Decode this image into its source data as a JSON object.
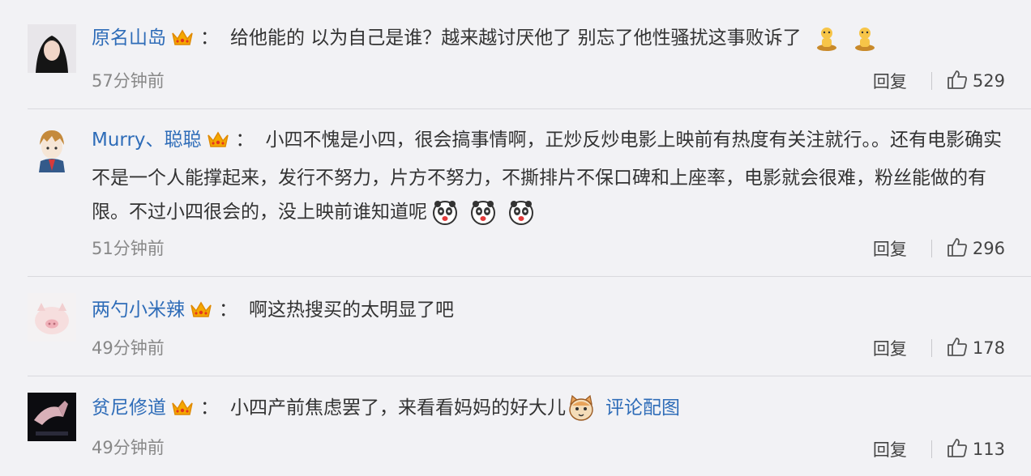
{
  "comments": [
    {
      "username": "原名山岛",
      "colon": "：",
      "text": "给他能的 以为自己是谁？越来越讨厌他了 别忘了他性骚扰这事败诉了",
      "time": "57分钟前",
      "reply_label": "回复",
      "likes": "529"
    },
    {
      "username": "Murry、聪聪",
      "colon": "：",
      "text": "小四不愧是小四，很会搞事情啊，正炒反炒电影上映前有热度有关注就行。。还有电影确实不是一个人能撑起来，发行不努力，片方不努力，不撕排片不保口碑和上座率，电影就会很难，粉丝能做的有限。不过小四很会的，没上映前谁知道呢",
      "time": "51分钟前",
      "reply_label": "回复",
      "likes": "296"
    },
    {
      "username": "两勺小米辣",
      "colon": "：",
      "text": "啊这热搜买的太明显了吧",
      "time": "49分钟前",
      "reply_label": "回复",
      "likes": "178"
    },
    {
      "username": "贫尼修道",
      "colon": "：",
      "text": "小四产前焦虑罢了，来看看妈妈的好大儿",
      "link": "评论配图",
      "time": "49分钟前",
      "reply_label": "回复",
      "likes": "113"
    }
  ],
  "colors": {
    "background": "#f2f2f5",
    "username": "#2e6cb8",
    "crown": "#f5a800",
    "timestamp": "#888888"
  },
  "icons": {
    "crown": "crown-icon",
    "like": "thumbs-up-icon",
    "emoji_1": "yellow-figure-emoji",
    "emoji_2": "panda-face-emoji",
    "emoji_4": "cat-face-emoji"
  }
}
